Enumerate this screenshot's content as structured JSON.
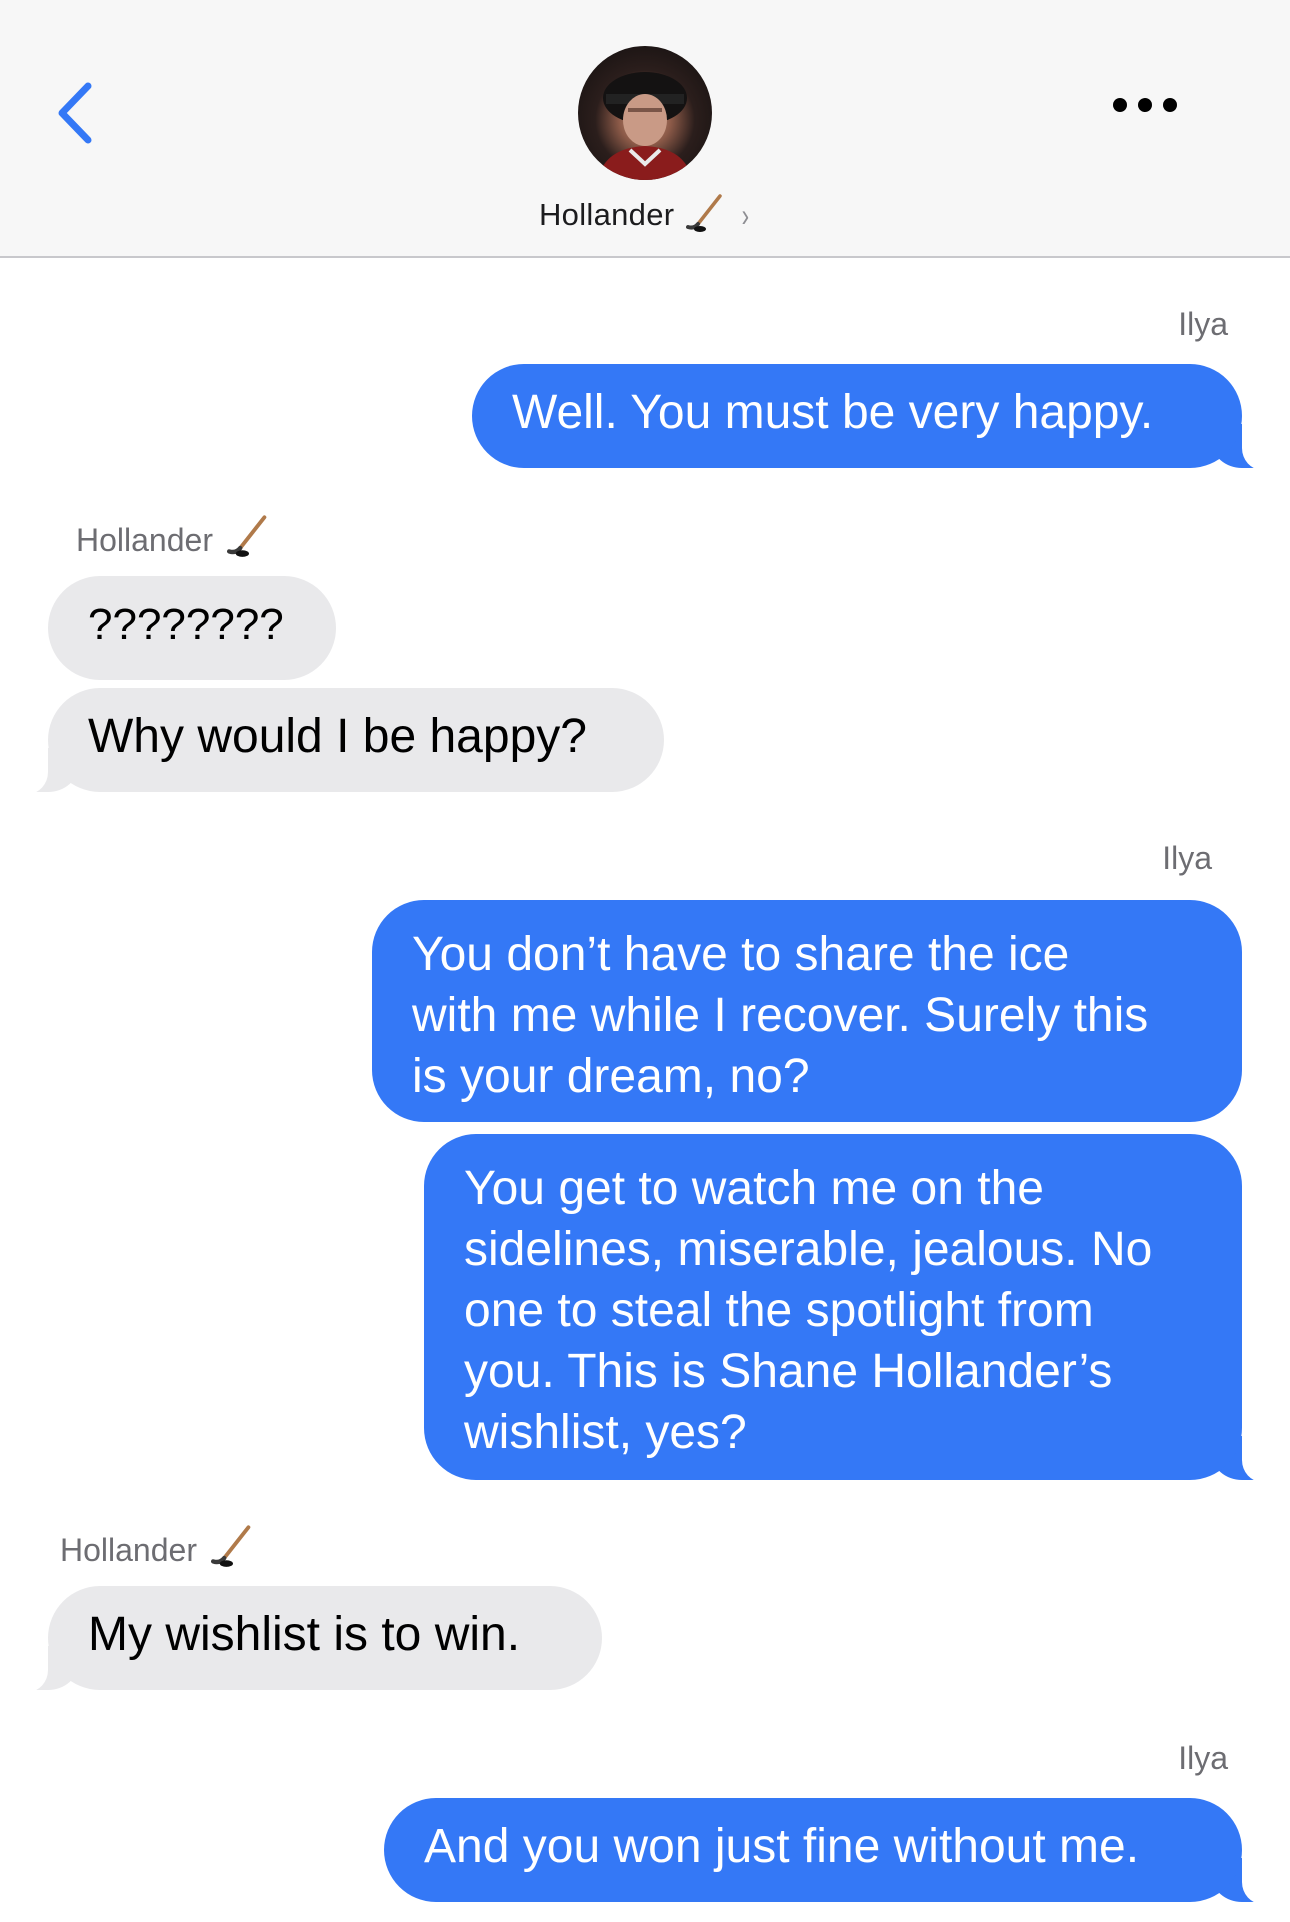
{
  "header": {
    "contact_name": "Hollander",
    "contact_icon": "hockey-stick-icon",
    "back_icon": "chevron-left-icon",
    "more_icon": "ellipsis-icon",
    "chevron": "›"
  },
  "theme": {
    "outgoing_color": "#3478f6",
    "incoming_color": "#e9e9eb",
    "accent": "#3478f6"
  },
  "messages": [
    {
      "sender": "Ilya",
      "direction": "outgoing",
      "text": "Well. You must be very happy."
    },
    {
      "sender": "Hollander",
      "direction": "incoming",
      "text": "????????"
    },
    {
      "sender": "Hollander",
      "direction": "incoming",
      "text": "Why would I be happy?"
    },
    {
      "sender": "Ilya",
      "direction": "outgoing",
      "lines": [
        "You don’t have to share the ice",
        "with me while I recover. Surely this",
        "is your dream, no?"
      ]
    },
    {
      "sender": "Ilya",
      "direction": "outgoing",
      "lines": [
        "You get to watch me on the",
        "sidelines, miserable, jealous. No",
        "one to steal the spotlight from",
        "you. This is Shane Hollander’s",
        "wishlist, yes?"
      ]
    },
    {
      "sender": "Hollander",
      "direction": "incoming",
      "text": "My wishlist is to win."
    },
    {
      "sender": "Ilya",
      "direction": "outgoing",
      "text": "And you won just fine without me."
    }
  ],
  "labels": {
    "ilya": "Ilya",
    "hollander": "Hollander"
  }
}
